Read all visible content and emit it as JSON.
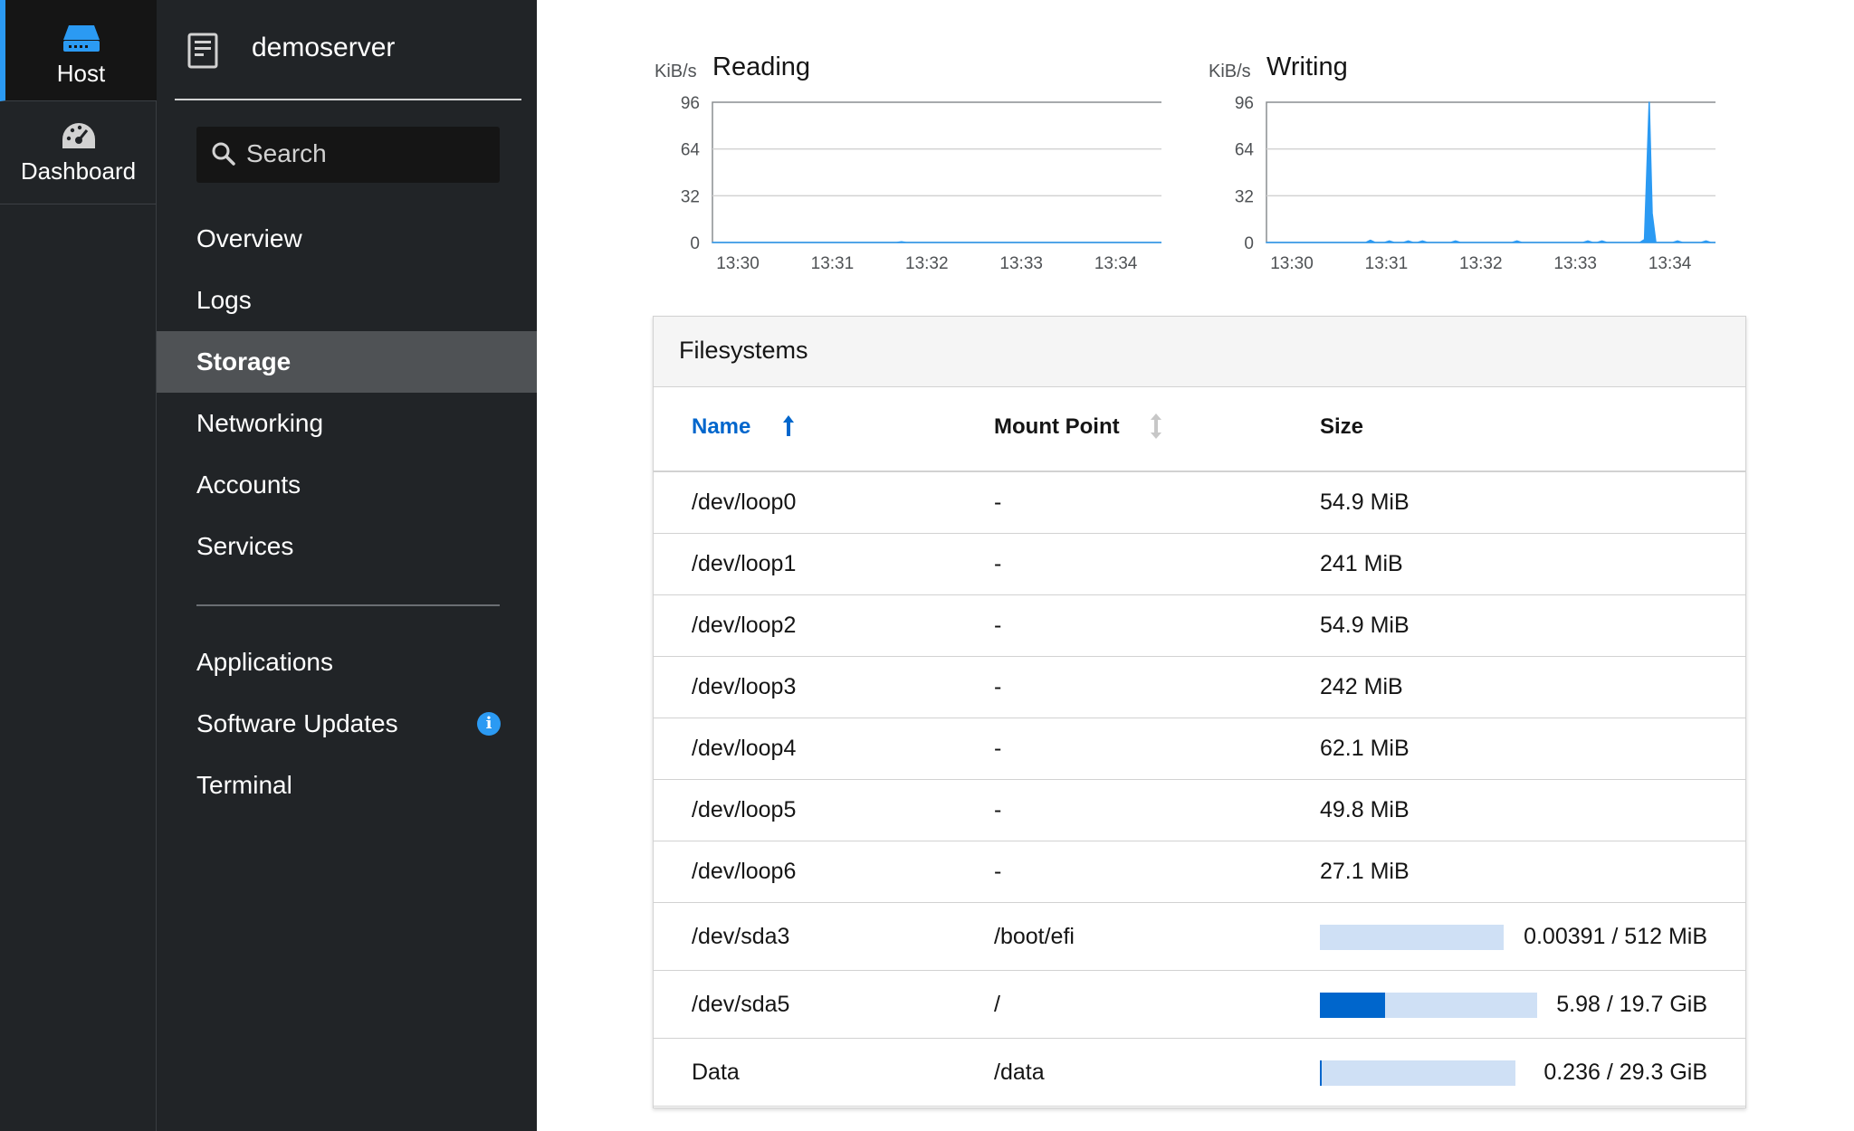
{
  "rail": {
    "host_label": "Host",
    "dashboard_label": "Dashboard"
  },
  "nav": {
    "server_name": "demoserver",
    "search_placeholder": "Search",
    "items": [
      {
        "label": "Overview"
      },
      {
        "label": "Logs"
      },
      {
        "label": "Storage",
        "active": true
      },
      {
        "label": "Networking"
      },
      {
        "label": "Accounts"
      },
      {
        "label": "Services"
      },
      {
        "label": "Applications"
      },
      {
        "label": "Software Updates"
      },
      {
        "label": "Terminal"
      }
    ],
    "updates_badge": "i"
  },
  "colors": {
    "accent": "#0066cc",
    "chart_line": "#2b9af3",
    "bar_track": "#cfe0f5",
    "sidebar_bg": "#212427"
  },
  "chart_data": [
    {
      "type": "area",
      "title": "Reading",
      "unit": "KiB/s",
      "x_ticks": [
        "13:30",
        "13:31",
        "13:32",
        "13:33",
        "13:34"
      ],
      "y_ticks": [
        0,
        32,
        64,
        96
      ],
      "ylim": [
        0,
        96
      ],
      "xlim": [
        0,
        5
      ],
      "x": [
        0,
        1.95,
        2.0,
        2.05,
        5
      ],
      "values": [
        0,
        0,
        0.5,
        0,
        0
      ]
    },
    {
      "type": "area",
      "title": "Writing",
      "unit": "KiB/s",
      "x_ticks": [
        "13:30",
        "13:31",
        "13:32",
        "13:33",
        "13:34"
      ],
      "y_ticks": [
        0,
        32,
        64,
        96
      ],
      "ylim": [
        0,
        96
      ],
      "xlim": [
        0,
        5
      ],
      "x": [
        0,
        1.05,
        1.1,
        1.15,
        1.25,
        1.3,
        1.35,
        1.45,
        1.5,
        1.55,
        1.6,
        1.65,
        1.7,
        1.95,
        2.0,
        2.05,
        2.6,
        2.65,
        2.7,
        2.6,
        3.35,
        3.4,
        3.45,
        3.5,
        3.55,
        3.6,
        3.95,
        4.0,
        4.05,
        4.08,
        4.12,
        4.3,
        4.35,
        4.4,
        4.6,
        4.65,
        4.7,
        4.8,
        4.85,
        4.9,
        4.95,
        5
      ],
      "values": [
        0,
        0,
        1.5,
        0,
        0,
        1,
        0,
        0,
        1,
        0,
        0,
        1,
        0,
        0,
        1,
        0,
        0,
        1,
        0,
        0,
        0,
        1,
        0,
        0,
        1,
        0,
        0,
        2,
        96,
        20,
        0,
        0,
        1,
        0,
        0,
        1,
        0,
        0,
        1,
        0,
        1,
        0
      ]
    }
  ],
  "filesystems": {
    "title": "Filesystems",
    "columns": {
      "name": "Name",
      "mount": "Mount Point",
      "size": "Size"
    },
    "rows": [
      {
        "name": "/dev/loop0",
        "mount": "-",
        "size": "54.9 MiB"
      },
      {
        "name": "/dev/loop1",
        "mount": "-",
        "size": "241 MiB"
      },
      {
        "name": "/dev/loop2",
        "mount": "-",
        "size": "54.9 MiB"
      },
      {
        "name": "/dev/loop3",
        "mount": "-",
        "size": "242 MiB"
      },
      {
        "name": "/dev/loop4",
        "mount": "-",
        "size": "62.1 MiB"
      },
      {
        "name": "/dev/loop5",
        "mount": "-",
        "size": "49.8 MiB"
      },
      {
        "name": "/dev/loop6",
        "mount": "-",
        "size": "27.1 MiB"
      },
      {
        "name": "/dev/sda3",
        "mount": "/boot/efi",
        "usage": "0.00391 / 512 MiB",
        "fraction": 0.0
      },
      {
        "name": "/dev/sda5",
        "mount": "/",
        "usage": "5.98 / 19.7 GiB",
        "fraction": 0.3
      },
      {
        "name": "Data",
        "mount": "/data",
        "usage": "0.236 / 29.3 GiB",
        "fraction": 0.01
      }
    ]
  }
}
